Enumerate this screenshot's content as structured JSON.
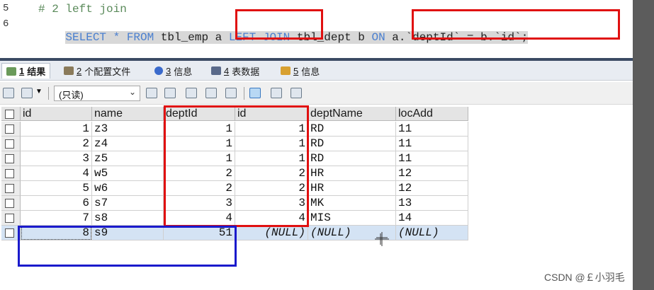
{
  "editor": {
    "lines": [
      {
        "num": "5",
        "text": "# 2 left join"
      },
      {
        "num": "6",
        "parts": {
          "p1": "SELECT * FROM ",
          "p2": "tbl_emp a ",
          "p3": "LEFT JOIN",
          "p4": " tbl_dept b ",
          "p5": "ON",
          "p6": " a.`deptId` = b.`id`;"
        }
      }
    ]
  },
  "tabs": [
    {
      "num": "1",
      "label": "结果",
      "icon": "result-grid-icon"
    },
    {
      "num": "2",
      "label": "个配置文件",
      "icon": "profile-icon"
    },
    {
      "num": "3",
      "label": "信息",
      "icon": "info-icon"
    },
    {
      "num": "4",
      "label": "表数据",
      "icon": "table-data-icon"
    },
    {
      "num": "5",
      "label": "信息",
      "icon": "info-icon"
    }
  ],
  "toolbar": {
    "readonly_value": "(只读)"
  },
  "grid": {
    "columns": [
      "id",
      "name",
      "deptId",
      "id",
      "deptName",
      "locAdd"
    ],
    "rows": [
      [
        "1",
        "z3",
        "1",
        "1",
        "RD",
        "11"
      ],
      [
        "2",
        "z4",
        "1",
        "1",
        "RD",
        "11"
      ],
      [
        "3",
        "z5",
        "1",
        "1",
        "RD",
        "11"
      ],
      [
        "4",
        "w5",
        "2",
        "2",
        "HR",
        "12"
      ],
      [
        "5",
        "w6",
        "2",
        "2",
        "HR",
        "12"
      ],
      [
        "6",
        "s7",
        "3",
        "3",
        "MK",
        "13"
      ],
      [
        "7",
        "s8",
        "4",
        "4",
        "MIS",
        "14"
      ],
      [
        "8",
        "s9",
        "51",
        "(NULL)",
        "(NULL)",
        "(NULL)"
      ]
    ]
  },
  "watermark": "CSDN @￡小羽毛",
  "colors": {
    "keyword": "#4a7fcf",
    "comment": "#5a8a5a",
    "annotation_red": "#e01010",
    "annotation_blue": "#1a1acc",
    "selected_row": "#d4e3f4"
  }
}
